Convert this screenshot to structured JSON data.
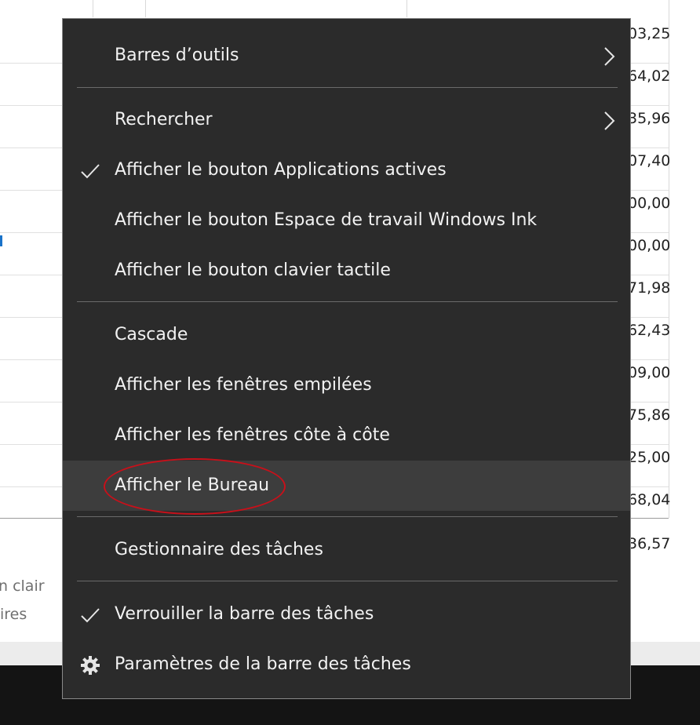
{
  "spreadsheet": {
    "cells": [
      "03,25",
      "64,02",
      "35,96",
      "07,40",
      "00,00",
      "00,00",
      "71,98",
      "62,43",
      "09,00",
      "75,86",
      "25,00",
      "68,04",
      "36,57"
    ],
    "partial_texts": [
      "n clair",
      "ires"
    ]
  },
  "menu": {
    "items": [
      {
        "label": "Barres d’outils",
        "submenu": true
      },
      {
        "label": "Rechercher",
        "submenu": true
      },
      {
        "label": "Afficher le bouton Applications actives",
        "checked": true
      },
      {
        "label": "Afficher le bouton Espace de travail Windows Ink"
      },
      {
        "label": "Afficher le bouton clavier tactile"
      },
      {
        "label": "Cascade"
      },
      {
        "label": "Afficher les fenêtres empilées"
      },
      {
        "label": "Afficher les fenêtres côte à côte"
      },
      {
        "label": "Afficher le Bureau",
        "highlighted": true
      },
      {
        "label": "Gestionnaire des tâches"
      },
      {
        "label": "Verrouiller la barre des tâches",
        "checked": true
      },
      {
        "label": "Paramètres de la barre des tâches",
        "icon": "gear-icon"
      }
    ]
  },
  "colors": {
    "menu_bg": "#2b2b2b",
    "hover_bg": "#3d3d3d",
    "annotation": "#c8101a",
    "taskbar": "#141414"
  }
}
